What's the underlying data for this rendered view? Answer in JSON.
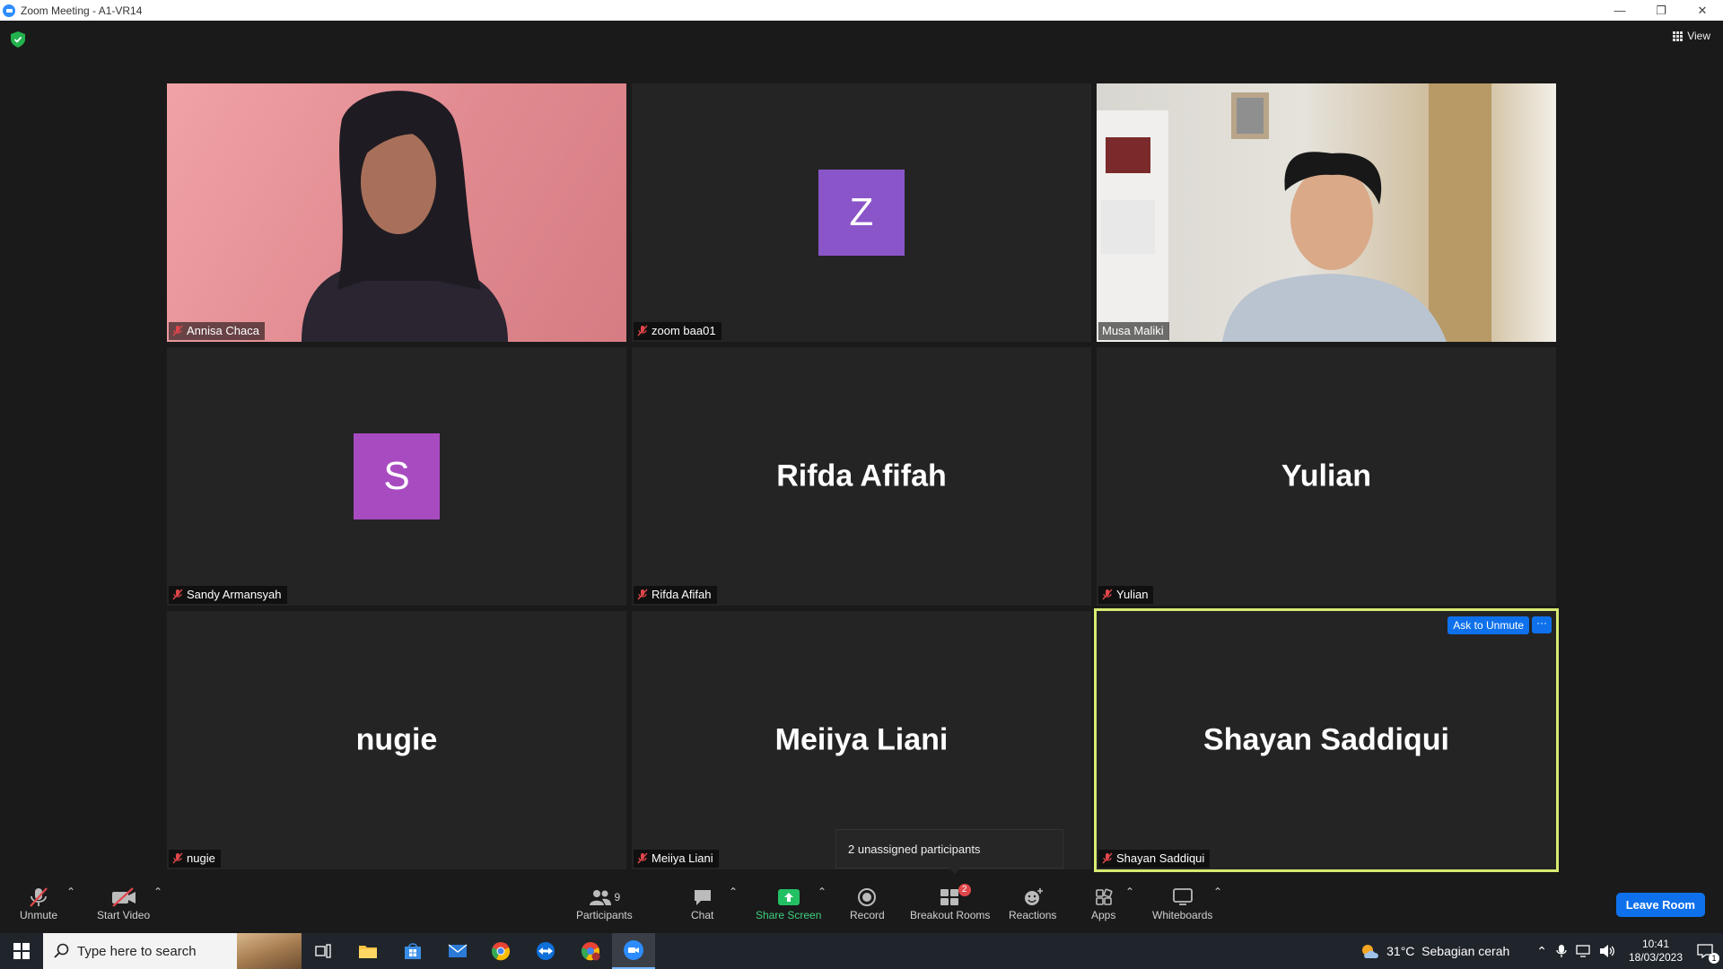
{
  "window": {
    "title": "Zoom Meeting - A1-VR14",
    "minimize": "—",
    "restore": "❐",
    "close": "✕"
  },
  "view_button": {
    "label": "View"
  },
  "tiles": [
    {
      "name": "Annisa Chaca",
      "type": "video",
      "muted": true
    },
    {
      "name": "zoom baa01",
      "type": "avatar",
      "initial": "Z",
      "color": "#8a55c8",
      "muted": true
    },
    {
      "name": "Musa Maliki",
      "type": "video",
      "muted": false
    },
    {
      "name": "Sandy Armansyah",
      "type": "avatar",
      "initial": "S",
      "color": "#a84bc0",
      "muted": true
    },
    {
      "name": "Rifda Afifah",
      "type": "name",
      "muted": true
    },
    {
      "name": "Yulian",
      "type": "name",
      "muted": true
    },
    {
      "name": "nugie",
      "type": "name",
      "muted": true
    },
    {
      "name": "Meiiya Liani",
      "type": "name",
      "muted": true
    },
    {
      "name": "Shayan Saddiqui",
      "type": "name",
      "muted": true,
      "active_speaker": true
    }
  ],
  "active_tile": {
    "ask_unmute": "Ask to Unmute",
    "more": "···"
  },
  "tooltip": {
    "text": "2 unassigned participants"
  },
  "toolbar": {
    "unmute": "Unmute",
    "start_video": "Start Video",
    "participants": "Participants",
    "participants_count": "9",
    "chat": "Chat",
    "share_screen": "Share Screen",
    "record": "Record",
    "breakout_rooms": "Breakout Rooms",
    "breakout_badge": "2",
    "reactions": "Reactions",
    "apps": "Apps",
    "whiteboards": "Whiteboards",
    "leave_room": "Leave Room"
  },
  "taskbar": {
    "search_placeholder": "Type here to search",
    "weather": "31°C  Sebagian cerah",
    "time": "10:41",
    "date": "18/03/2023",
    "notification_count": "1"
  },
  "colors": {
    "accent_blue": "#0e71eb",
    "active_border": "#d9ea72",
    "share_green": "#3ed07d",
    "mute_red": "#e0464a"
  }
}
